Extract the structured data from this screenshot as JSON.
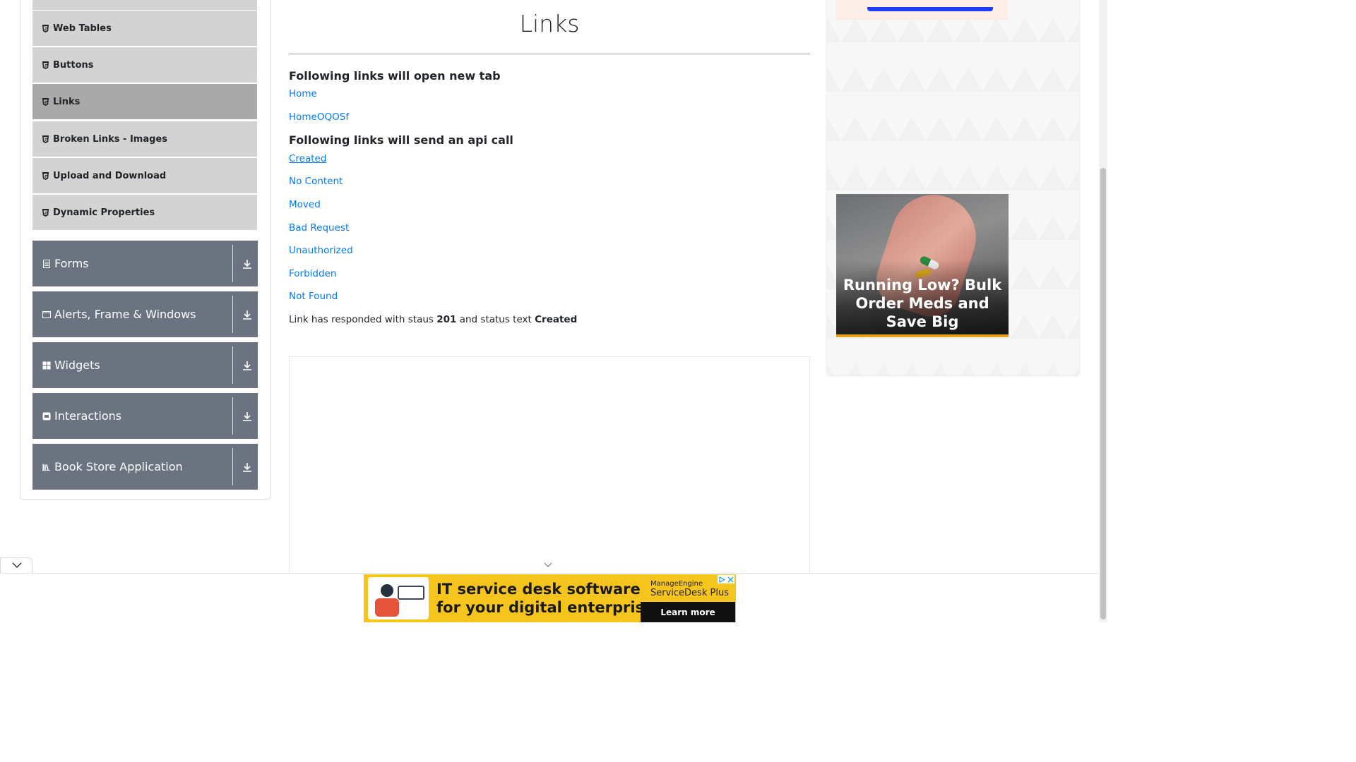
{
  "sidebar": {
    "elements_items": [
      {
        "label": "Web Tables",
        "active": false
      },
      {
        "label": "Buttons",
        "active": false
      },
      {
        "label": "Links",
        "active": true
      },
      {
        "label": "Broken Links - Images",
        "active": false
      },
      {
        "label": "Upload and Download",
        "active": false
      },
      {
        "label": "Dynamic Properties",
        "active": false
      }
    ],
    "groups": [
      {
        "label": "Forms",
        "icon": "form-icon"
      },
      {
        "label": "Alerts, Frame & Windows",
        "icon": "window-icon"
      },
      {
        "label": "Widgets",
        "icon": "widgets-icon"
      },
      {
        "label": "Interactions",
        "icon": "interactions-icon"
      },
      {
        "label": "Book Store Application",
        "icon": "book-icon"
      }
    ]
  },
  "main": {
    "title": "Links",
    "new_tab_heading": "Following links will open new tab",
    "new_tab_links": [
      "Home",
      "HomeOQOSf"
    ],
    "api_heading": "Following links will send an api call",
    "api_links": [
      "Created",
      "No Content",
      "Moved",
      "Bad Request",
      "Unauthorized",
      "Forbidden",
      "Not Found"
    ],
    "response": {
      "prefix": "Link has responded with staus",
      "status": "201",
      "middle": "and status text",
      "status_text": "Created"
    }
  },
  "right_ad": {
    "text": "Running Low? Bulk Order Meds and Save Big"
  },
  "bottom_ad": {
    "headline_line1": "IT service desk software",
    "headline_line2": "for your digital enterprise",
    "brand_line1": "ManageEngine",
    "brand_line2": "ServiceDesk Plus",
    "cta": "Learn more"
  },
  "colors": {
    "link": "#007bff",
    "group_bg": "#6b7280",
    "item_bg": "#d3d3d3",
    "item_active_bg": "#a9a9a9",
    "banner_bg": "#f6c51d"
  }
}
